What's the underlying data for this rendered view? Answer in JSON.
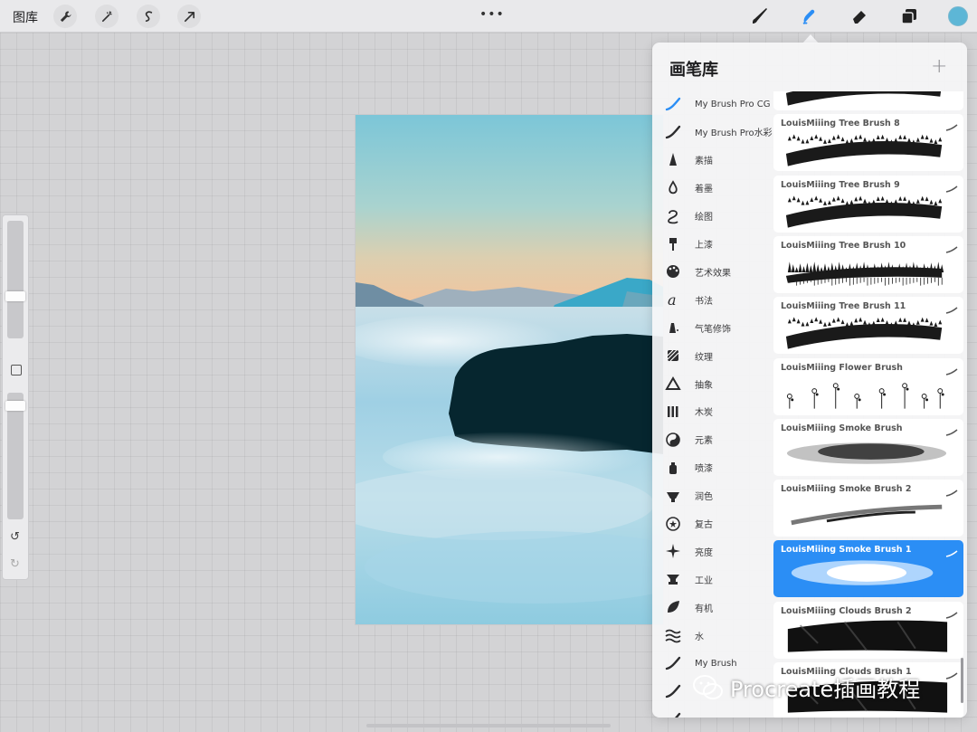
{
  "topbar": {
    "gallery_label": "图库",
    "more_label": "•••",
    "tools_left": [
      "wrench-icon",
      "magic-wand-icon",
      "selection-icon",
      "transform-arrow-icon"
    ],
    "tools_right": [
      "paintbrush-icon",
      "smudge-icon",
      "eraser-icon",
      "layers-icon"
    ],
    "active_tool": "smudge-icon",
    "active_color": "#5db6d6",
    "active_tool_color": "#2b8ef5"
  },
  "sidebar": {
    "undo_label": "↺",
    "redo_label": "↻"
  },
  "panel": {
    "title": "画笔库",
    "add_label": "+",
    "sets": [
      {
        "label": "My Brush Pro CG",
        "icon": "brush-stroke-icon",
        "active": true
      },
      {
        "label": "My Brush Pro水彩",
        "icon": "brush-stroke-icon"
      },
      {
        "label": "素描",
        "icon": "pencil-icon"
      },
      {
        "label": "着墨",
        "icon": "ink-drop-icon"
      },
      {
        "label": "绘图",
        "icon": "drawing-swirl-icon"
      },
      {
        "label": "上漆",
        "icon": "paint-brush-icon"
      },
      {
        "label": "艺术效果",
        "icon": "palette-icon"
      },
      {
        "label": "书法",
        "icon": "calligraphy-icon"
      },
      {
        "label": "气笔修饰",
        "icon": "airbrush-icon"
      },
      {
        "label": "纹理",
        "icon": "texture-icon"
      },
      {
        "label": "抽象",
        "icon": "abstract-triangle-icon"
      },
      {
        "label": "木炭",
        "icon": "charcoal-icon"
      },
      {
        "label": "元素",
        "icon": "yin-yang-icon"
      },
      {
        "label": "喷漆",
        "icon": "spray-can-icon"
      },
      {
        "label": "润色",
        "icon": "touchup-icon"
      },
      {
        "label": "复古",
        "icon": "retro-star-icon"
      },
      {
        "label": "亮度",
        "icon": "sparkle-icon"
      },
      {
        "label": "工业",
        "icon": "anvil-icon"
      },
      {
        "label": "有机",
        "icon": "leaf-icon"
      },
      {
        "label": "水",
        "icon": "water-waves-icon"
      },
      {
        "label": "My Brush",
        "icon": "brush-stroke-icon"
      },
      {
        "label": "",
        "icon": "brush-stroke-icon"
      },
      {
        "label": "",
        "icon": "brush-stroke-icon"
      }
    ],
    "brushes": [
      {
        "name": "",
        "stroke": "tree",
        "partial": true
      },
      {
        "name": "LouisMiiing Tree Brush 8",
        "stroke": "tree-dense"
      },
      {
        "name": "LouisMiiing Tree Brush 9",
        "stroke": "tree-dense"
      },
      {
        "name": "LouisMiiing Tree Brush 10",
        "stroke": "tree-spiky"
      },
      {
        "name": "LouisMiiing Tree Brush 11",
        "stroke": "tree-dense"
      },
      {
        "name": "LouisMiiing Flower Brush",
        "stroke": "flower"
      },
      {
        "name": "LouisMiiing Smoke Brush",
        "stroke": "smoke"
      },
      {
        "name": "LouisMiiing Smoke Brush 2",
        "stroke": "smoke-thin"
      },
      {
        "name": "LouisMiiing Smoke Brush 1",
        "stroke": "cloud",
        "selected": true
      },
      {
        "name": "LouisMiiing Clouds Brush 2",
        "stroke": "clouds-dark"
      },
      {
        "name": "LouisMiiing Clouds Brush 1",
        "stroke": "clouds-dark"
      }
    ]
  },
  "watermark": {
    "text": "Procreate插画教程",
    "icon": "wechat-icon"
  }
}
